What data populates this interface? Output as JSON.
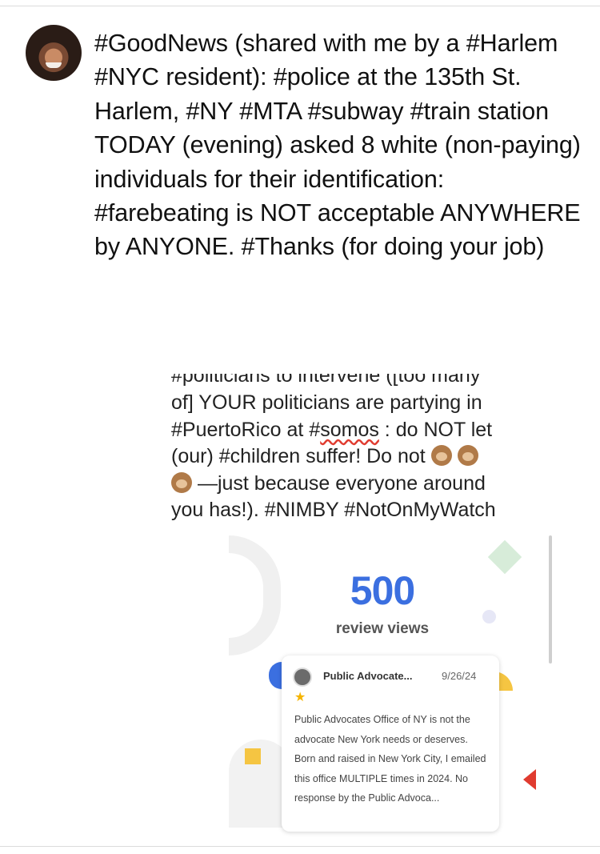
{
  "post": {
    "text": "#GoodNews (shared with me by a #Harlem #NYC resident): #police at the 135th St. Harlem, #NY #MTA #subway #train station TODAY (evening) asked 8 white (non-paying) individuals for their identification: #farebeating is NOT acceptable ANYWHERE by ANYONE. #Thanks (for doing your job)"
  },
  "embed": {
    "cut_line": "#politicians to intervene ([too many",
    "line1": "of] YOUR politicians are partying in",
    "line2_a": "#PuertoRico at #",
    "line2_b": "somos",
    "line2_c": " : do NOT let",
    "line3": "(our) #children suffer! Do not ",
    "line4": " —just because everyone around",
    "line5": "you has!). #NIMBY #NotOnMyWatch",
    "emoji": [
      "see-no-evil-monkey",
      "hear-no-evil-monkey",
      "speak-no-evil-monkey"
    ]
  },
  "review": {
    "count": "500",
    "count_label": "review views",
    "reviewer": "Public Advocate...",
    "date": "9/26/24",
    "stars": "★",
    "body": "Public Advocates Office of NY is not the advocate New York needs or deserves. Born and raised in New York City, I emailed this office MULTIPLE times in 2024. No response by the Public Advoca..."
  },
  "colors": {
    "accent_blue": "#3b6fe0",
    "star_yellow": "#f5b400",
    "divider": "#dcdcdc"
  }
}
